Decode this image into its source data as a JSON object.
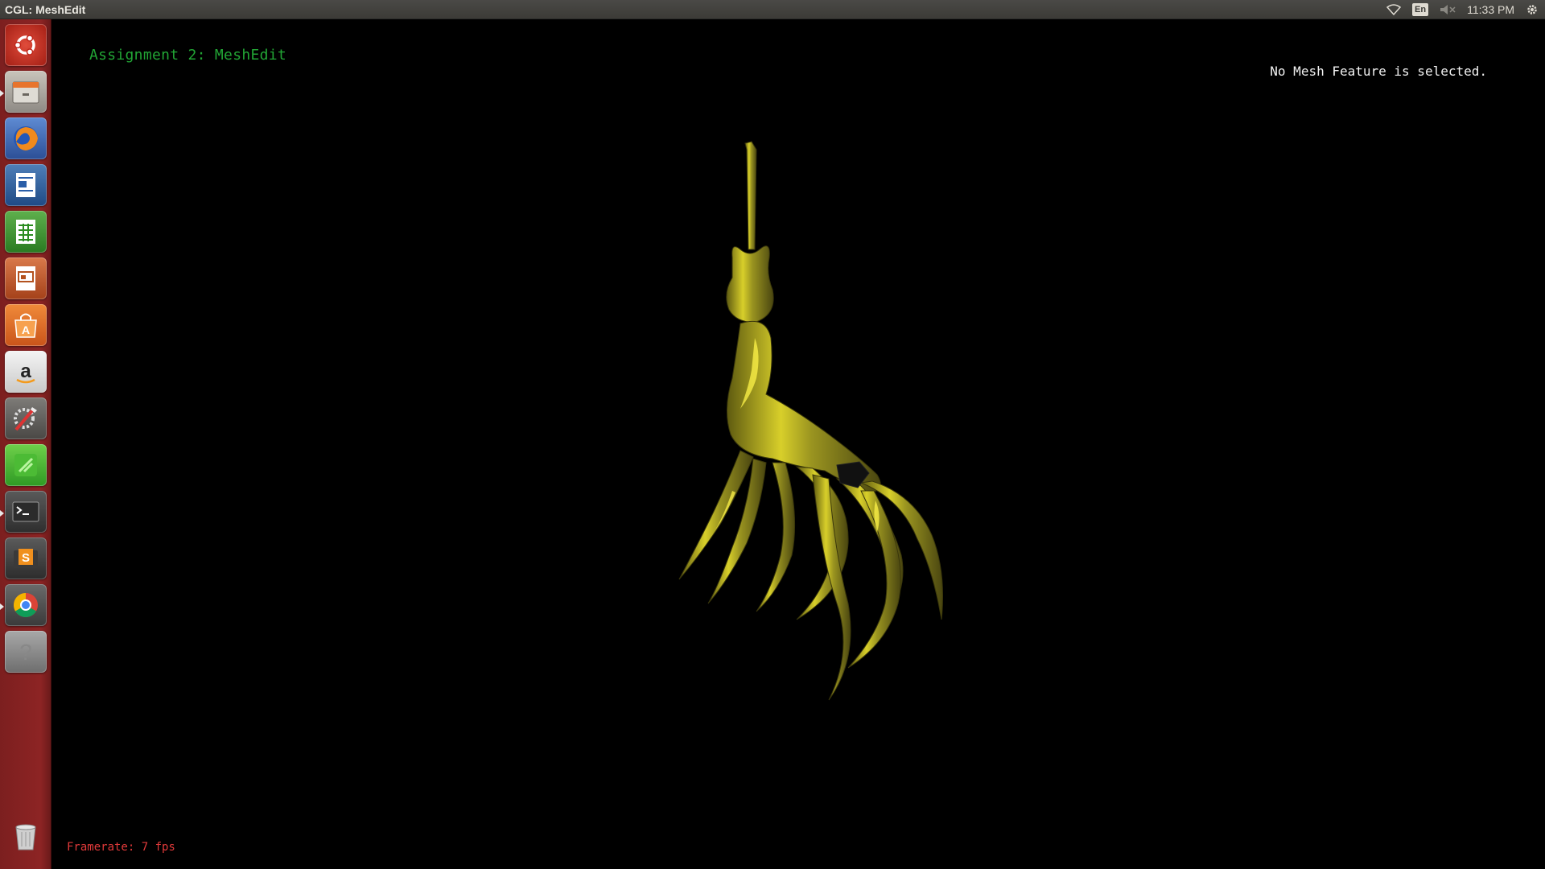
{
  "topbar": {
    "window_title": "CGL: MeshEdit",
    "keyboard_layout": "En",
    "clock": "11:33 PM",
    "icons": [
      "wifi-icon",
      "keyboard-layout-indicator",
      "volume-muted-icon",
      "settings-gear-icon"
    ]
  },
  "launcher": {
    "items": [
      {
        "name": "dash-home",
        "icon": "ubuntu-logo-icon"
      },
      {
        "name": "files",
        "icon": "file-cabinet-icon"
      },
      {
        "name": "firefox",
        "icon": "firefox-icon"
      },
      {
        "name": "libreoffice-writer",
        "icon": "writer-document-icon"
      },
      {
        "name": "libreoffice-calc",
        "icon": "calc-spreadsheet-icon"
      },
      {
        "name": "libreoffice-impress",
        "icon": "impress-presentation-icon"
      },
      {
        "name": "software-center",
        "icon": "shopping-bag-icon"
      },
      {
        "name": "amazon",
        "icon": "amazon-icon"
      },
      {
        "name": "system-settings",
        "icon": "wrench-screwdriver-icon"
      },
      {
        "name": "app-green",
        "icon": "green-app-icon"
      },
      {
        "name": "terminal",
        "icon": "terminal-icon"
      },
      {
        "name": "sublime-text",
        "icon": "sublime-text-icon"
      },
      {
        "name": "chrome",
        "icon": "chrome-icon"
      },
      {
        "name": "unknown-app",
        "icon": "question-mark-icon"
      },
      {
        "name": "trash",
        "icon": "trash-icon"
      }
    ]
  },
  "viewport": {
    "assignment_title": "Assignment 2: MeshEdit",
    "selection_status": "No Mesh Feature is selected.",
    "framerate": "Framerate: 7 fps"
  },
  "colors": {
    "title_green": "#22a535",
    "framerate_red": "#e23a3a",
    "mesh_gold": "#9a9420",
    "launcher_red": "#8d2424"
  }
}
